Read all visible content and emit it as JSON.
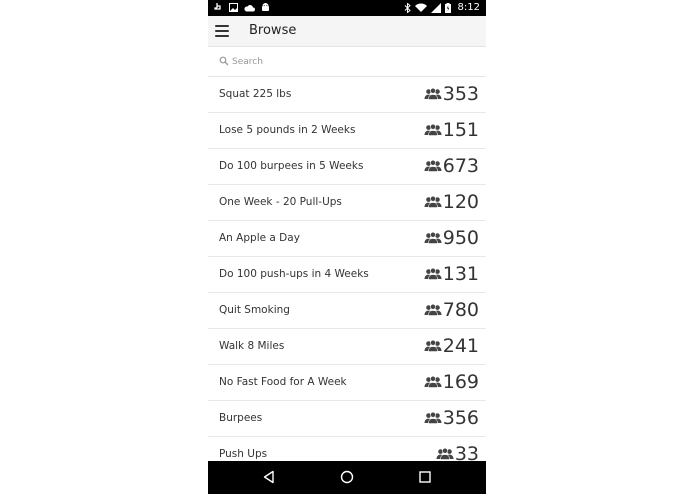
{
  "status_bar": {
    "time": "8:12",
    "left_icons": [
      "hand-icon",
      "image-icon",
      "cloud-icon",
      "android-icon"
    ],
    "right_icons": [
      "bluetooth-icon",
      "wifi-icon",
      "signal-icon",
      "battery-icon"
    ]
  },
  "app_bar": {
    "title": "Browse"
  },
  "search": {
    "placeholder": "Search"
  },
  "list": [
    {
      "label": "Squat 225 lbs",
      "count": "353"
    },
    {
      "label": "Lose 5 pounds in 2 Weeks",
      "count": "151"
    },
    {
      "label": "Do 100 burpees in 5 Weeks",
      "count": "673"
    },
    {
      "label": "One Week - 20 Pull-Ups",
      "count": "120"
    },
    {
      "label": "An Apple a Day",
      "count": "950"
    },
    {
      "label": "Do 100 push-ups in 4 Weeks",
      "count": "131"
    },
    {
      "label": "Quit Smoking",
      "count": "780"
    },
    {
      "label": "Walk 8 Miles",
      "count": "241"
    },
    {
      "label": "No Fast Food for A Week",
      "count": "169"
    },
    {
      "label": "Burpees",
      "count": "356"
    },
    {
      "label": "Push Ups",
      "count": "33"
    }
  ],
  "nav_bar": {
    "icons": [
      "back-icon",
      "home-icon",
      "recents-icon"
    ]
  },
  "colors": {
    "status_bar": "#000000",
    "app_bar": "#f5f5f5",
    "text": "#333333",
    "divider": "#e8e8e8"
  }
}
